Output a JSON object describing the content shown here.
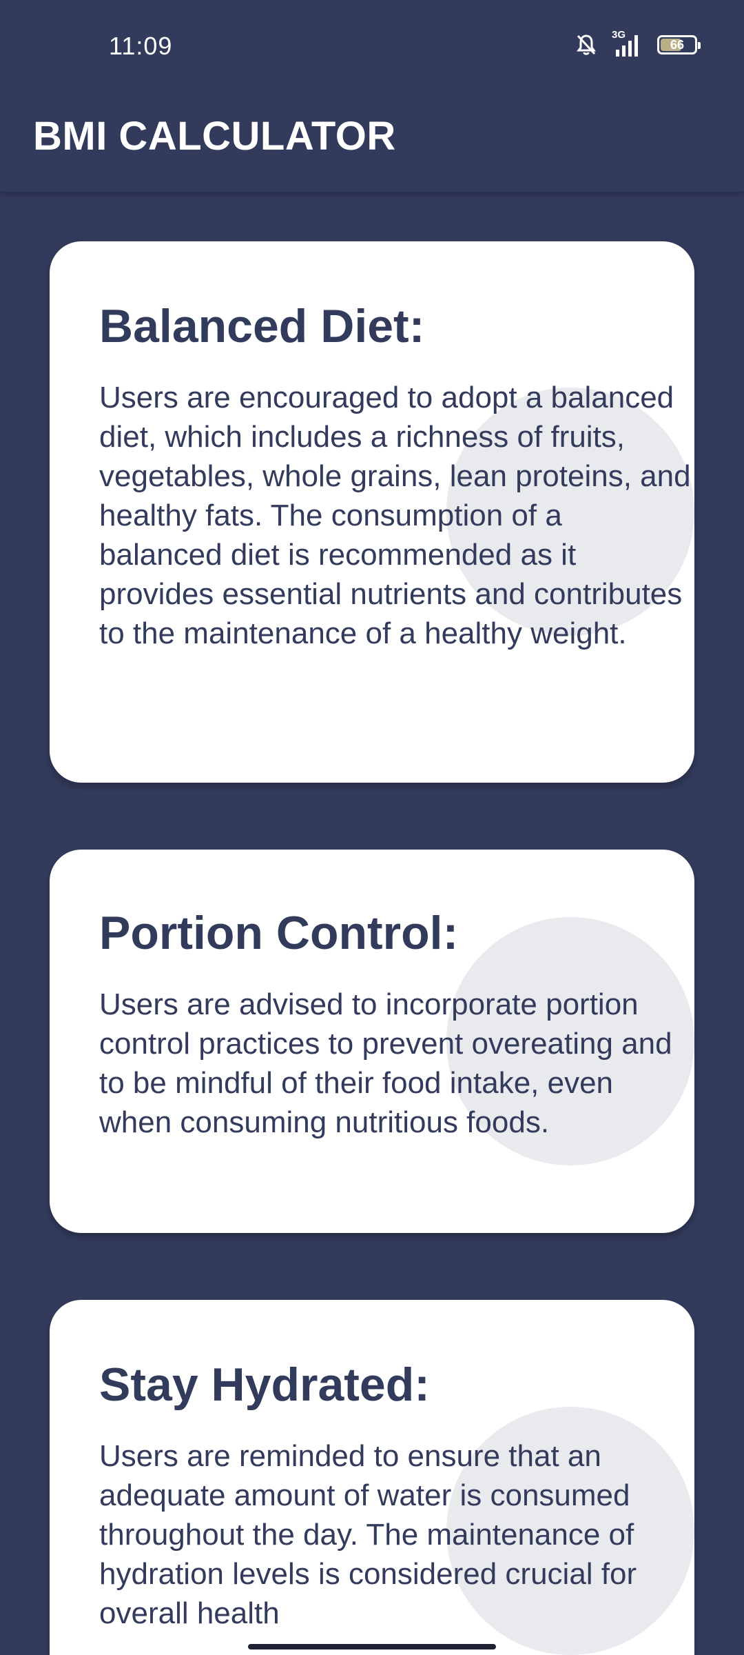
{
  "status_bar": {
    "time": "11:09",
    "network": "3G",
    "battery_level": "66",
    "battery_fraction": 0.66,
    "icons": [
      "bell-off-icon",
      "signal-icon",
      "battery-icon"
    ]
  },
  "app_bar": {
    "title": "BMI CALCULATOR"
  },
  "cards": [
    {
      "title": "Balanced Diet:",
      "body": "Users are encouraged to adopt a balanced diet, which includes a richness of fruits, vegetables, whole grains, lean proteins, and healthy fats. The consumption of a balanced diet is recommended as it provides essential nutrients and contributes to the maintenance of a healthy weight."
    },
    {
      "title": "Portion Control:",
      "body": "Users are advised to incorporate portion control practices to prevent overeating and to be mindful of their food intake, even when consuming nutritious foods."
    },
    {
      "title": "Stay Hydrated:",
      "body": "Users are reminded to ensure that an adequate amount of water is consumed throughout the day. The maintenance of hydration levels is considered crucial for overall health"
    }
  ],
  "colors": {
    "background": "#333b5c",
    "card": "#ffffff",
    "card_text": "#333b5c",
    "decor_circle": "#e9eaee"
  }
}
